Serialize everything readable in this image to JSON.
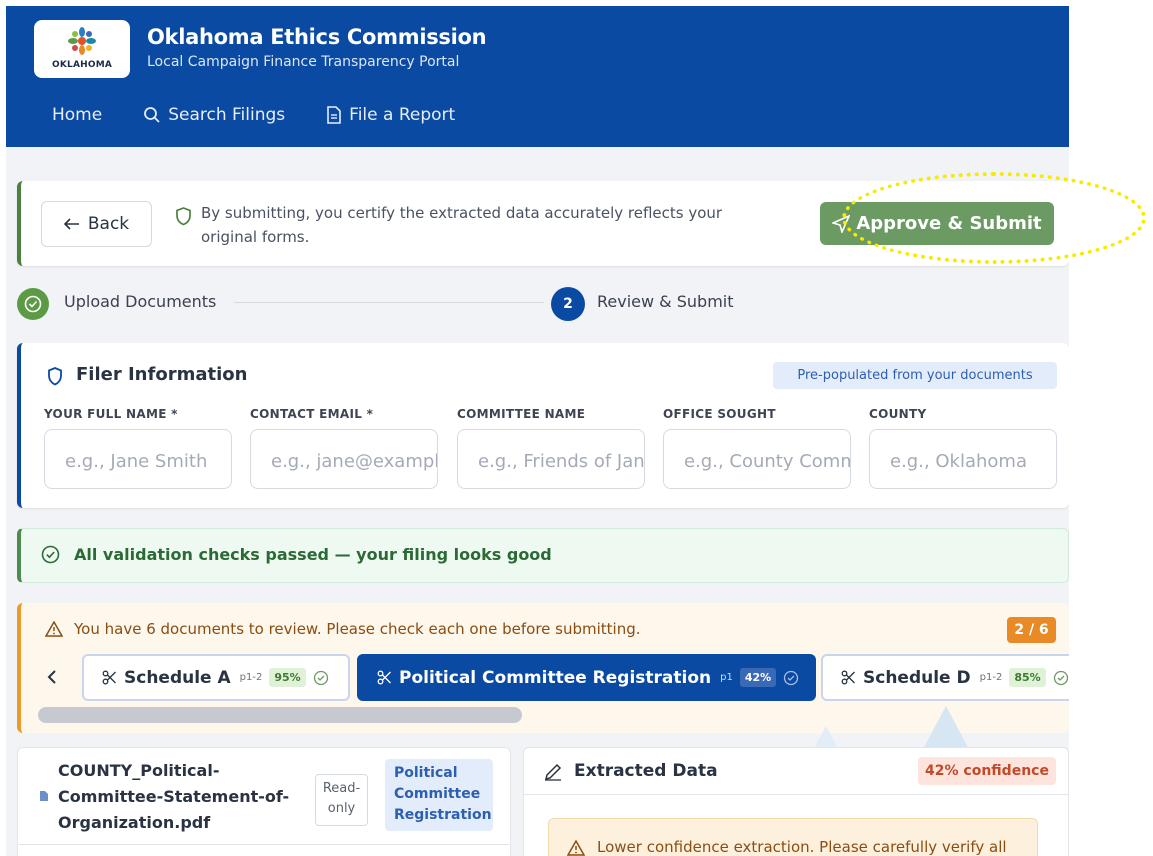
{
  "header": {
    "logo_text": "OKLAHOMA",
    "title": "Oklahoma Ethics Commission",
    "subtitle": "Local Campaign Finance Transparency Portal",
    "nav": [
      {
        "label": "Home",
        "icon": "none"
      },
      {
        "label": "Search Filings",
        "icon": "search-icon"
      },
      {
        "label": "File a Report",
        "icon": "document-icon"
      }
    ],
    "bg_color": "#0a4aa3"
  },
  "action_bar": {
    "back_label": "Back",
    "certify_text": "By submitting, you certify the extracted data accurately reflects your original forms.",
    "submit_label": "Approve & Submit",
    "submit_color": "#6b9a63"
  },
  "steps": [
    {
      "number": "1",
      "label": "Upload Documents",
      "status": "complete"
    },
    {
      "number": "2",
      "label": "Review & Submit",
      "status": "current"
    }
  ],
  "filer": {
    "title": "Filer Information",
    "badge": "Pre-populated from your documents",
    "fields": [
      {
        "label": "YOUR FULL NAME *",
        "placeholder": "e.g., Jane Smith",
        "value": ""
      },
      {
        "label": "CONTACT EMAIL *",
        "placeholder": "e.g., jane@example.com",
        "value": ""
      },
      {
        "label": "COMMITTEE NAME",
        "placeholder": "e.g., Friends of Jane",
        "value": ""
      },
      {
        "label": "OFFICE SOUGHT",
        "placeholder": "e.g., County Commissioner",
        "value": ""
      },
      {
        "label": "COUNTY",
        "placeholder": "e.g., Oklahoma",
        "value": ""
      }
    ]
  },
  "validation": {
    "text": "All validation checks passed — your filing looks good",
    "color": "#2c6a35"
  },
  "review": {
    "text": "You have 6 documents to review. Please check each one before submitting.",
    "count": "2 / 6",
    "tabs": [
      {
        "label": "Schedule A",
        "pages": "p1-2",
        "confidence": "95%",
        "active": false
      },
      {
        "label": "Political Committee Registration",
        "pages": "p1",
        "confidence": "42%",
        "active": true
      },
      {
        "label": "Schedule D",
        "pages": "p1-2",
        "confidence": "85%",
        "active": false
      }
    ]
  },
  "document": {
    "filename": "COUNTY_Political-Committee-Statement-of-Organization.pdf",
    "readonly": "Read-only",
    "type": "Political Committee Registration"
  },
  "extracted": {
    "title": "Extracted Data",
    "confidence": "42% confidence",
    "warning": "Lower confidence extraction. Please carefully verify all"
  }
}
